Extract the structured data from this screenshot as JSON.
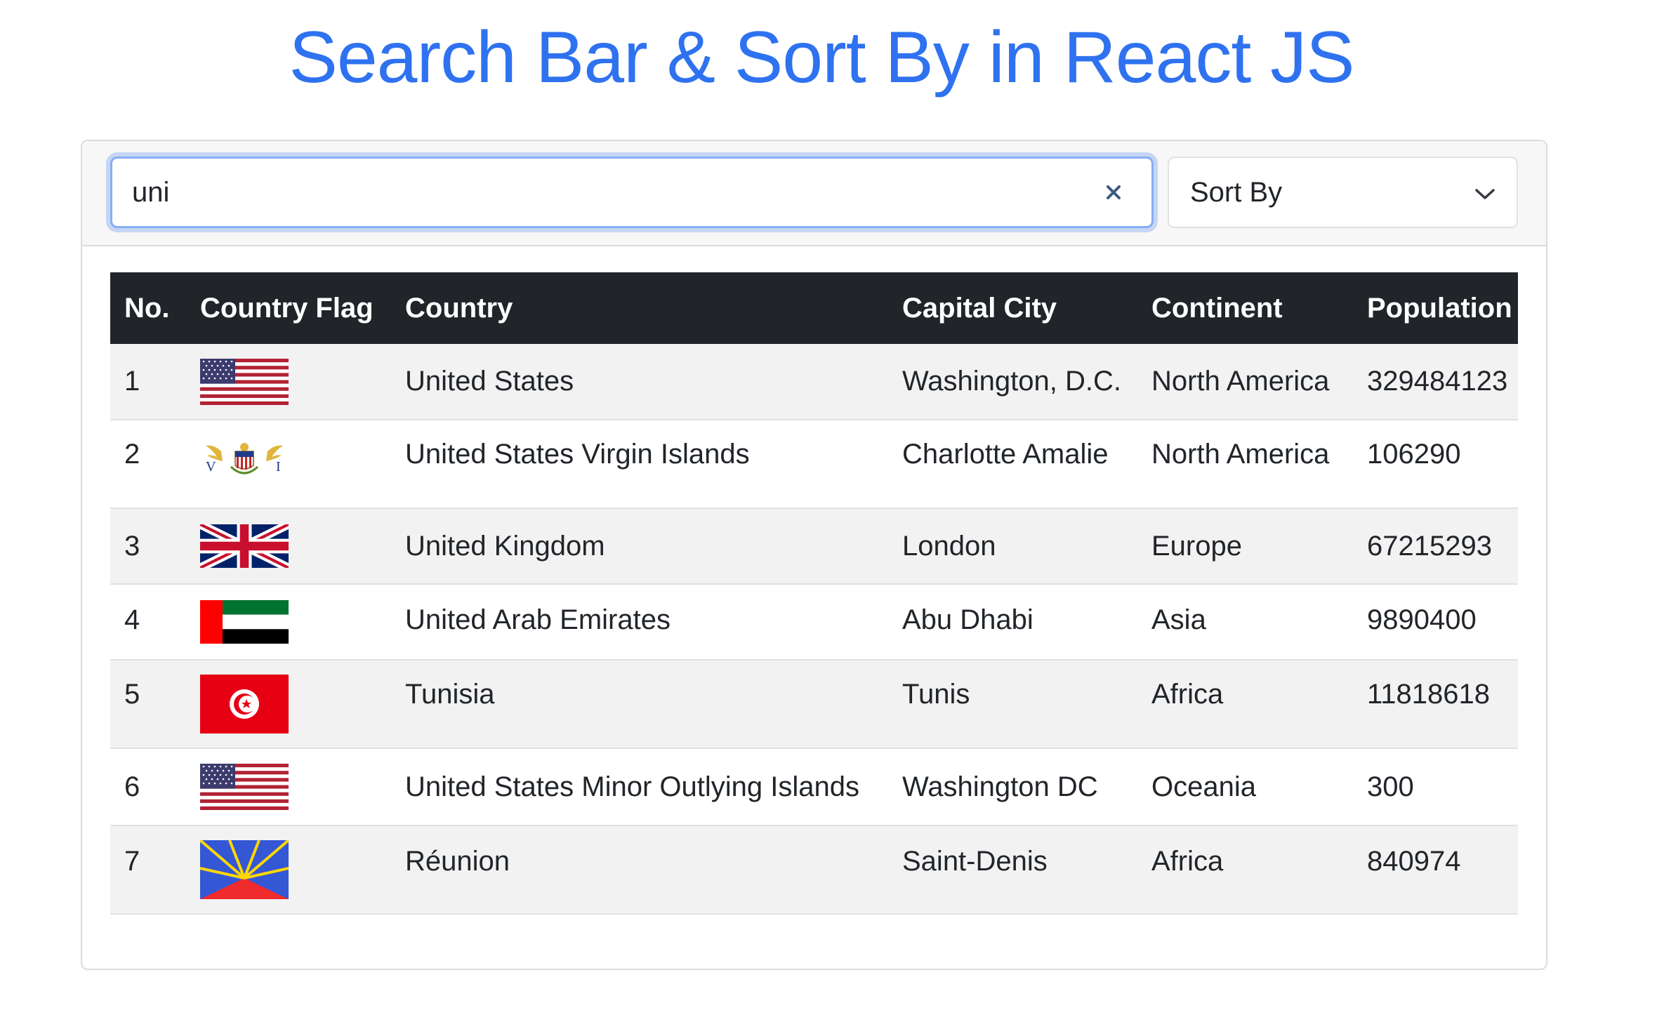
{
  "page": {
    "title": "Search Bar & Sort By in React JS"
  },
  "search": {
    "value": "uni",
    "clear_icon": "close-icon"
  },
  "sort": {
    "label": "Sort By",
    "icon": "chevron-down-icon"
  },
  "table": {
    "headers": {
      "no": "No.",
      "flag": "Country Flag",
      "country": "Country",
      "capital": "Capital City",
      "continent": "Continent",
      "population": "Population"
    },
    "rows": [
      {
        "no": "1",
        "flag": "us-flag",
        "country": "United States",
        "capital": "Washington, D.C.",
        "continent": "North America",
        "population": "329484123"
      },
      {
        "no": "2",
        "flag": "vi-flag",
        "country": "United States Virgin Islands",
        "capital": "Charlotte Amalie",
        "continent": "North America",
        "population": "106290"
      },
      {
        "no": "3",
        "flag": "gb-flag",
        "country": "United Kingdom",
        "capital": "London",
        "continent": "Europe",
        "population": "67215293"
      },
      {
        "no": "4",
        "flag": "ae-flag",
        "country": "United Arab Emirates",
        "capital": "Abu Dhabi",
        "continent": "Asia",
        "population": "9890400"
      },
      {
        "no": "5",
        "flag": "tn-flag",
        "country": "Tunisia",
        "capital": "Tunis",
        "continent": "Africa",
        "population": "11818618"
      },
      {
        "no": "6",
        "flag": "us-flag",
        "country": "United States Minor Outlying Islands",
        "capital": "Washington DC",
        "continent": "Oceania",
        "population": "300"
      },
      {
        "no": "7",
        "flag": "re-flag",
        "country": "Réunion",
        "capital": "Saint-Denis",
        "continent": "Africa",
        "population": "840974"
      }
    ]
  },
  "colors": {
    "title": "#2f72f0",
    "header_bg": "#212529",
    "stripe": "#f2f2f2",
    "focus_border": "#86aef5"
  }
}
